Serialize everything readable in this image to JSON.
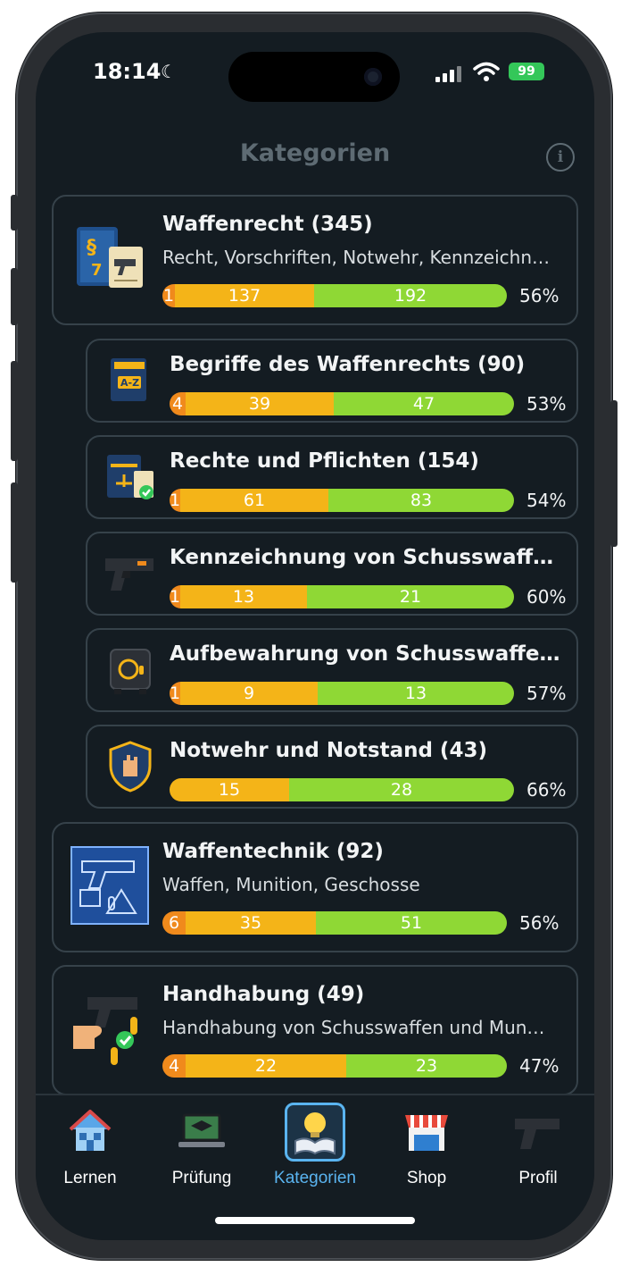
{
  "status": {
    "time": "18:14",
    "battery": "99"
  },
  "header": {
    "title": "Kategorien"
  },
  "categories": [
    {
      "title": "Waffenrecht  (345)",
      "subtitle": "Recht, Vorschriften, Notwehr, Kennzeichn…",
      "orange": "1",
      "yellow": "137",
      "green": "192",
      "percent": "56%"
    },
    {
      "title": "Begriffe des Waffenrechts (90)",
      "orange": "4",
      "yellow": "39",
      "green": "47",
      "percent": "53%"
    },
    {
      "title": "Rechte und Pflichten (154)",
      "orange": "1",
      "yellow": "61",
      "green": "83",
      "percent": "54%"
    },
    {
      "title": "Kennzeichnung von Schusswaffen u…",
      "orange": "1",
      "yellow": "13",
      "green": "21",
      "percent": "60%"
    },
    {
      "title": "Aufbewahrung von Schusswaffen un…",
      "orange": "1",
      "yellow": "9",
      "green": "13",
      "percent": "57%"
    },
    {
      "title": "Notwehr und Notstand (43)",
      "orange": "",
      "yellow": "15",
      "green": "28",
      "percent": "66%"
    },
    {
      "title": "Waffentechnik  (92)",
      "subtitle": "Waffen, Munition, Geschosse",
      "orange": "6",
      "yellow": "35",
      "green": "51",
      "percent": "56%"
    },
    {
      "title": "Handhabung  (49)",
      "subtitle": "Handhabung von Schusswaffen und Mun…",
      "orange": "4",
      "yellow": "22",
      "green": "23",
      "percent": "47%"
    }
  ],
  "nav": [
    {
      "label": "Lernen",
      "icon": "house-icon"
    },
    {
      "label": "Prüfung",
      "icon": "laptop-graduation-icon"
    },
    {
      "label": "Kategorien",
      "icon": "lightbulb-book-icon"
    },
    {
      "label": "Shop",
      "icon": "shop-icon"
    },
    {
      "label": "Profil",
      "icon": "pistol-icon"
    }
  ],
  "colors": {
    "orange": "#f08a1c",
    "yellow": "#f4b418",
    "green": "#8fd835",
    "accent": "#5ab4f0",
    "background": "#141c22"
  }
}
